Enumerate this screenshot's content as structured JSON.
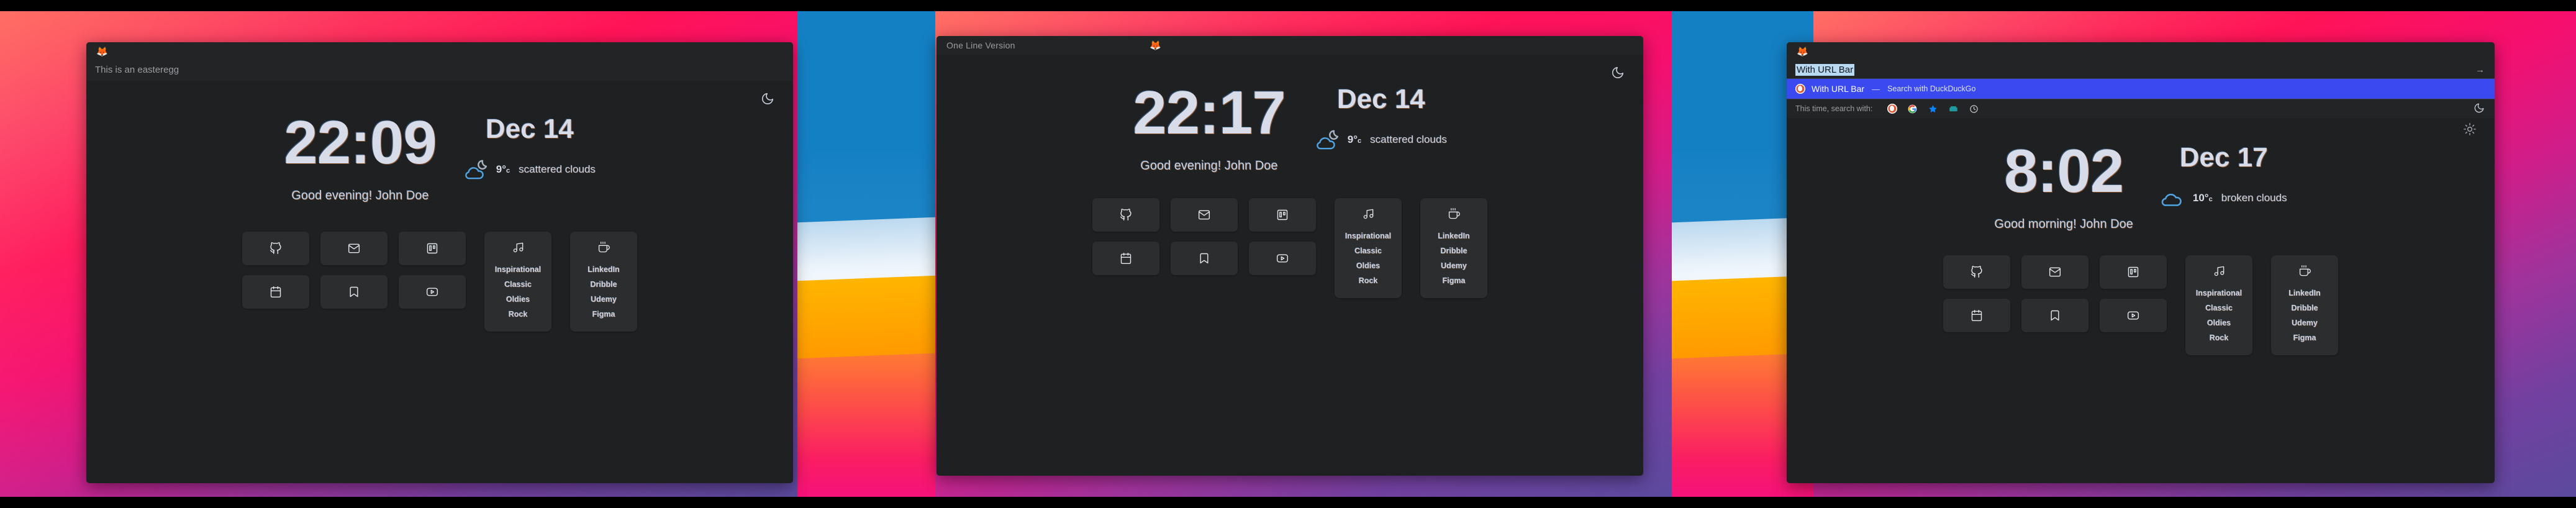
{
  "windows": [
    {
      "chrome": {
        "fox_icon": "firefox-fox-emoji",
        "title": "This is an easteregg",
        "has_urlbar": false
      },
      "moon_icon": "moon-icon",
      "clock": "22:09",
      "greeting": "Good evening! John Doe",
      "date": "Dec 14",
      "weather": {
        "icon": "cloud-moon-icon",
        "temp": "9°",
        "unit": "c",
        "description": "scattered clouds"
      },
      "tiles": [
        {
          "icon": "github-icon"
        },
        {
          "icon": "mail-icon"
        },
        {
          "icon": "trello-icon"
        },
        {
          "icon": "calendar-icon"
        },
        {
          "icon": "bookmark-icon"
        },
        {
          "icon": "youtube-icon"
        }
      ],
      "linkcards": [
        {
          "icon": "music-note-icon",
          "items": [
            "Inspirational",
            "Classic",
            "Oldies",
            "Rock"
          ]
        },
        {
          "icon": "coffee-cup-icon",
          "items": [
            "LinkedIn",
            "Dribble",
            "Udemy",
            "Figma"
          ]
        }
      ]
    },
    {
      "chrome": {
        "fox_icon": "firefox-fox-emoji",
        "title": "One Line Version",
        "has_urlbar": false
      },
      "moon_icon": "moon-icon",
      "clock": "22:17",
      "greeting": "Good evening! John Doe",
      "date": "Dec 14",
      "weather": {
        "icon": "cloud-moon-icon",
        "temp": "9°",
        "unit": "c",
        "description": "scattered clouds"
      },
      "tiles": [
        {
          "icon": "github-icon"
        },
        {
          "icon": "mail-icon"
        },
        {
          "icon": "trello-icon"
        },
        {
          "icon": "calendar-icon"
        },
        {
          "icon": "bookmark-icon"
        },
        {
          "icon": "youtube-icon"
        }
      ],
      "linkcards": [
        {
          "icon": "music-note-icon",
          "items": [
            "Inspirational",
            "Classic",
            "Oldies",
            "Rock"
          ]
        },
        {
          "icon": "coffee-cup-icon",
          "items": [
            "LinkedIn",
            "Dribble",
            "Udemy",
            "Figma"
          ]
        }
      ]
    },
    {
      "chrome": {
        "fox_icon": "firefox-fox-emoji",
        "title": "",
        "has_urlbar": true,
        "urlbar_value": "With URL Bar",
        "go_arrow": "arrow-right-icon",
        "suggestion": {
          "engine_icon": "duckduckgo-icon",
          "query": "With URL Bar",
          "dash": "—",
          "engine_text": "Search with DuckDuckGo"
        },
        "search_with_label": "This time, search with:",
        "search_engines": [
          {
            "name": "duckduckgo-icon",
            "color": "#de5833"
          },
          {
            "name": "google-icon",
            "color": "#4285f4"
          },
          {
            "name": "star-bookmarks-icon",
            "color": "#0a84ff"
          },
          {
            "name": "tabs-icon",
            "color": "#1f9aa0"
          },
          {
            "name": "history-clock-icon",
            "color": "#d0d4d8"
          }
        ],
        "chrome_moon_icon": "moon-icon"
      },
      "moon_icon": "sun-settings-icon",
      "clock": "8:02",
      "greeting": "Good morning! John Doe",
      "date": "Dec 17",
      "weather": {
        "icon": "cloud-icon",
        "temp": "10°",
        "unit": "c",
        "description": "broken clouds"
      },
      "tiles": [
        {
          "icon": "github-icon"
        },
        {
          "icon": "mail-icon"
        },
        {
          "icon": "trello-icon"
        },
        {
          "icon": "calendar-icon"
        },
        {
          "icon": "bookmark-icon"
        },
        {
          "icon": "youtube-icon"
        }
      ],
      "linkcards": [
        {
          "icon": "music-note-icon",
          "items": [
            "Inspirational",
            "Classic",
            "Oldies",
            "Rock"
          ]
        },
        {
          "icon": "coffee-cup-icon",
          "items": [
            "LinkedIn",
            "Dribble",
            "Udemy",
            "Figma"
          ]
        }
      ]
    }
  ],
  "theme": {
    "window_bg": "#1f2021",
    "chrome_bg": "#232425",
    "tile_bg": "#2b2d2f",
    "text": "#d7dce8",
    "muted": "#9a9ea2",
    "suggestion_bg": "#3a49f0",
    "weather_accent": "#4fa3e3"
  }
}
